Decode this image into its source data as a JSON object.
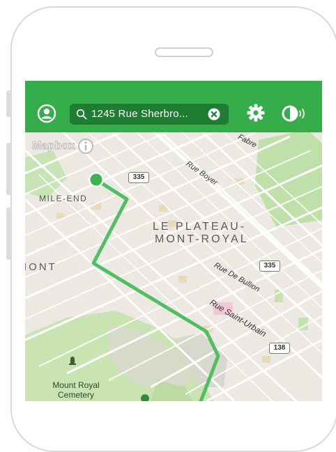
{
  "topbar": {
    "account_icon": "user-circle-icon",
    "search": {
      "icon": "magnifier-icon",
      "value": "1245 Rue Sherbro...",
      "clear_icon": "x-circle-icon"
    },
    "settings_icon": "gear-icon",
    "audio_icon": "speaker-waves-icon",
    "color": "#35ad4a"
  },
  "map": {
    "attribution": {
      "logo_text": "Mapbox",
      "info_icon": "info-icon"
    },
    "neighborhoods": [
      {
        "id": "mile-end",
        "text": "MILE-END"
      },
      {
        "id": "plateau-line1",
        "text": "LE PLATEAU-"
      },
      {
        "id": "plateau-line2",
        "text": "MONT-ROYAL"
      },
      {
        "id": "mont-partial",
        "text": "IONT"
      }
    ],
    "streets": [
      {
        "id": "fabre",
        "text": "Fabre"
      },
      {
        "id": "boyer",
        "text": "Rue Boyer"
      },
      {
        "id": "de-bullion",
        "text": "Rue De Bullion"
      },
      {
        "id": "saint-urbain",
        "text": "Rue Saint-Urbain"
      }
    ],
    "route_shields": [
      {
        "id": "shield-335-top",
        "text": "335"
      },
      {
        "id": "shield-335-mid",
        "text": "335"
      },
      {
        "id": "shield-138",
        "text": "138"
      }
    ],
    "parks": [
      {
        "id": "mount-royal-cemetery",
        "line1": "Mount Royal",
        "line2": "Cemetery"
      }
    ],
    "route_color": "#4fbf62",
    "origin_marker_color": "#3cb44d"
  }
}
